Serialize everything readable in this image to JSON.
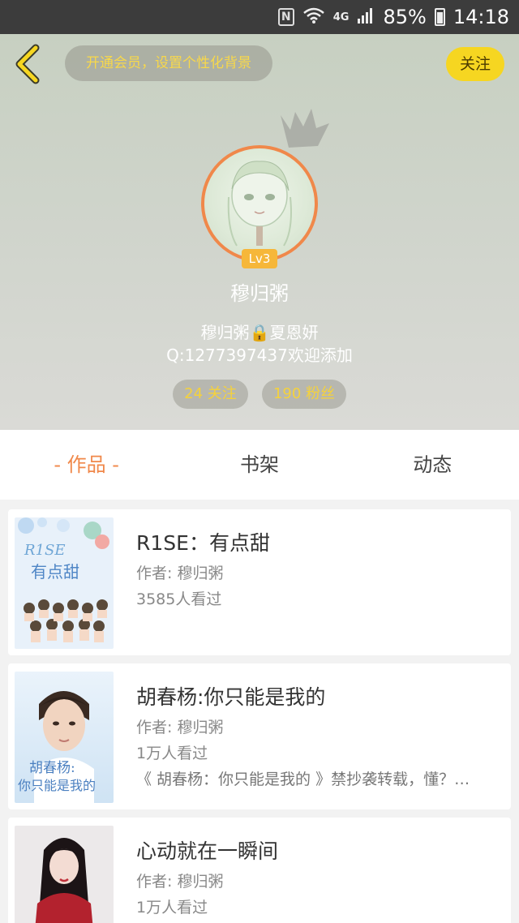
{
  "status_bar": {
    "battery": "85%",
    "time": "14:18",
    "network": "4G"
  },
  "header": {
    "vip_banner": "开通会员，设置个性化背景",
    "follow_label": "关注",
    "level": "Lv3",
    "username": "穆归粥",
    "bio_line1": "穆归粥🔒夏恩妍",
    "bio_line2": "Q:1277397437欢迎添加",
    "following": "24 关注",
    "fans": "190 粉丝",
    "colors": {
      "accent": "#f0884a",
      "follow_button": "#f6d621",
      "stat_text": "#f5d23c"
    }
  },
  "tabs": [
    {
      "label": "- 作品 -",
      "active": true
    },
    {
      "label": "书架",
      "active": false
    },
    {
      "label": "动态",
      "active": false
    }
  ],
  "works": [
    {
      "title": "R1SE：有点甜",
      "author": "作者: 穆归粥",
      "views": "3585人看过",
      "desc": ""
    },
    {
      "title": "胡春杨:你只能是我的",
      "author": "作者: 穆归粥",
      "views": "1万人看过",
      "desc": "《 胡春杨：你只能是我的 》禁抄袭转载，懂？…"
    },
    {
      "title": "心动就在一瞬间",
      "author": "作者: 穆归粥",
      "views": "1万人看过",
      "desc": ""
    }
  ]
}
